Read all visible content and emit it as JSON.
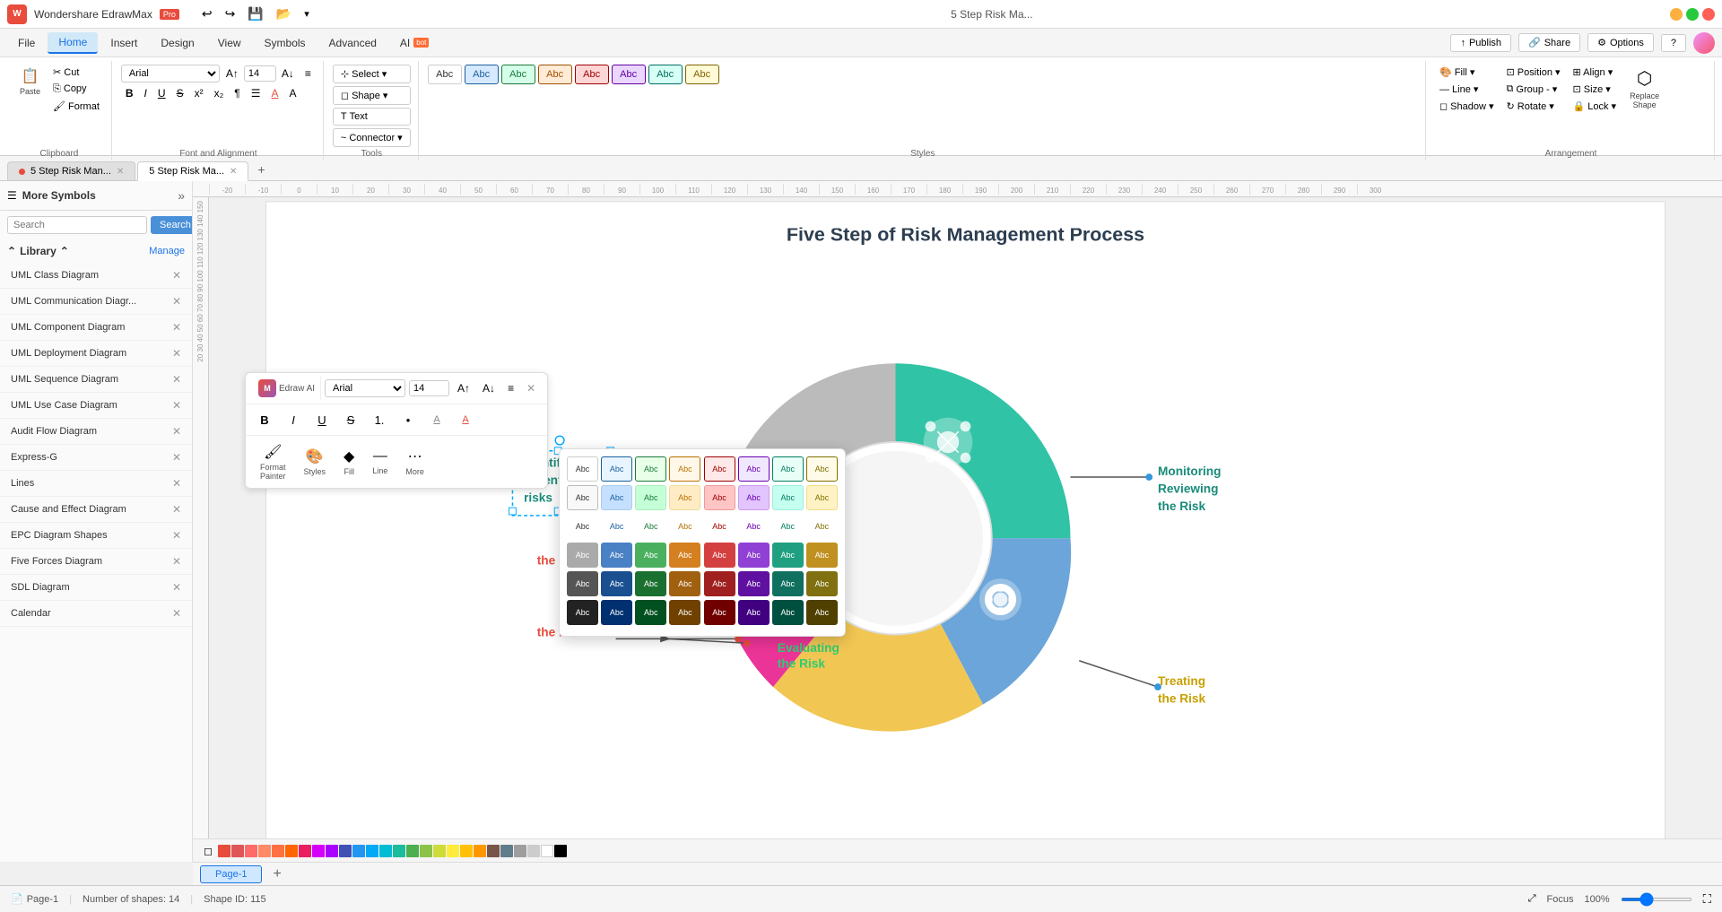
{
  "app": {
    "name": "Wondershare EdrawMax",
    "badge": "Pro",
    "title": "Wondershare EdrawMax Pro"
  },
  "titlebar": {
    "undo_label": "↩",
    "redo_label": "↪",
    "save_label": "💾",
    "open_label": "📂",
    "doc_title": "5 Step Risk Ma..."
  },
  "menubar": {
    "items": [
      {
        "label": "File",
        "active": false
      },
      {
        "label": "Home",
        "active": true
      },
      {
        "label": "Insert",
        "active": false
      },
      {
        "label": "Design",
        "active": false
      },
      {
        "label": "View",
        "active": false
      },
      {
        "label": "Symbols",
        "active": false
      },
      {
        "label": "Advanced",
        "active": false
      },
      {
        "label": "AI",
        "active": false,
        "badge": "bot"
      }
    ],
    "publish": "Publish",
    "share": "Share",
    "options": "Options"
  },
  "ribbon": {
    "clipboard": {
      "label": "Clipboard",
      "cut": "✂",
      "copy": "📋",
      "paste": "📌",
      "format_painter": "🖌"
    },
    "font": {
      "label": "Font and Alignment",
      "font_family": "Arial",
      "font_size": "14",
      "bold": "B",
      "italic": "I",
      "underline": "U",
      "strikethrough": "S",
      "superscript": "x²",
      "subscript": "x₂",
      "paragraph": "¶",
      "list": "☰",
      "font_color": "A",
      "font_bg": "A"
    },
    "tools": {
      "label": "Tools",
      "select": "Select",
      "shape": "Shape",
      "text": "Text",
      "connector": "Connector"
    },
    "styles": {
      "label": "Styles",
      "items": [
        "Abc",
        "Abc",
        "Abc",
        "Abc",
        "Abc",
        "Abc",
        "Abc",
        "Abc"
      ]
    },
    "arrangement": {
      "label": "Arrangement",
      "fill": "Fill",
      "line": "Line",
      "shadow": "Shadow",
      "position": "Position",
      "group": "Group -",
      "rotate": "Rotate",
      "align": "Align",
      "size": "Size",
      "lock": "Lock",
      "replace_shape": "Replace Shape"
    }
  },
  "tabs": [
    {
      "label": "5 Step Risk Man...",
      "active": false,
      "dot": true,
      "closable": true
    },
    {
      "label": "5 Step Risk Ma...",
      "active": true,
      "dot": false,
      "closable": true
    }
  ],
  "left_panel": {
    "title": "More Symbols",
    "search_placeholder": "Search",
    "search_btn": "Search",
    "library": "Library",
    "manage": "Manage",
    "items": [
      {
        "label": "UML Class Diagram",
        "removable": true
      },
      {
        "label": "UML Communication Diagr...",
        "removable": true
      },
      {
        "label": "UML Component Diagram",
        "removable": true
      },
      {
        "label": "UML Deployment Diagram",
        "removable": true
      },
      {
        "label": "UML Sequence Diagram",
        "removable": true
      },
      {
        "label": "UML Use Case Diagram",
        "removable": true
      },
      {
        "label": "Audit Flow Diagram",
        "removable": true,
        "active": false
      },
      {
        "label": "Express-G",
        "removable": true
      },
      {
        "label": "Lines",
        "removable": true
      },
      {
        "label": "Cause and Effect Diagram",
        "removable": true
      },
      {
        "label": "EPC Diagram Shapes",
        "removable": true
      },
      {
        "label": "Five Forces Diagram",
        "removable": true
      },
      {
        "label": "SDL Diagram",
        "removable": true
      },
      {
        "label": "Calendar",
        "removable": true
      }
    ]
  },
  "diagram": {
    "title": "Five Step of Risk Management Process",
    "labels": {
      "identify": "Identify\nPotential\nrisks",
      "monitoring": "Monitoring\nReviewing\nthe Risk",
      "treating": "Treating\nthe Risk",
      "evaluating": "Evaluating\nthe Risk",
      "risk": "the risk"
    }
  },
  "floating_toolbar": {
    "font_family": "Arial",
    "font_size": "14",
    "bold": "B",
    "italic": "I",
    "underline": "U",
    "strikethrough": "S",
    "list_ol": "1.",
    "list_ul": "•",
    "text_bg": "A",
    "text_color": "A",
    "format_painter": "Format\nPainter",
    "styles": "Styles",
    "fill": "Fill",
    "line": "Line",
    "more": "More",
    "edraw_ai": "Edraw AI"
  },
  "styles_popup": {
    "rows": [
      [
        "Abc",
        "Abc",
        "Abc",
        "Abc",
        "Abc",
        "Abc",
        "Abc",
        "Abc"
      ],
      [
        "Abc",
        "Abc",
        "Abc",
        "Abc",
        "Abc",
        "Abc",
        "Abc",
        "Abc"
      ],
      [
        "Abc",
        "Abc",
        "Abc",
        "Abc",
        "Abc",
        "Abc",
        "Abc",
        "Abc"
      ],
      [
        "Abc",
        "Abc",
        "Abc",
        "Abc",
        "Abc",
        "Abc",
        "Abc",
        "Abc"
      ],
      [
        "Abc",
        "Abc",
        "Abc",
        "Abc",
        "Abc",
        "Abc",
        "Abc",
        "Abc"
      ],
      [
        "Abc",
        "Abc",
        "Abc",
        "Abc",
        "Abc",
        "Abc",
        "Abc",
        "Abc"
      ]
    ]
  },
  "statusbar": {
    "page_indicator": "Page-1",
    "shapes_count": "Number of shapes: 14",
    "shape_id": "Shape ID: 115",
    "focus": "Focus",
    "zoom": "100%"
  },
  "colors": {
    "teal": "#1abc9c",
    "blue": "#3498db",
    "pink": "#e91e8c",
    "green": "#2ecc71",
    "yellow": "#f0c040",
    "accent": "#1a73e8"
  }
}
